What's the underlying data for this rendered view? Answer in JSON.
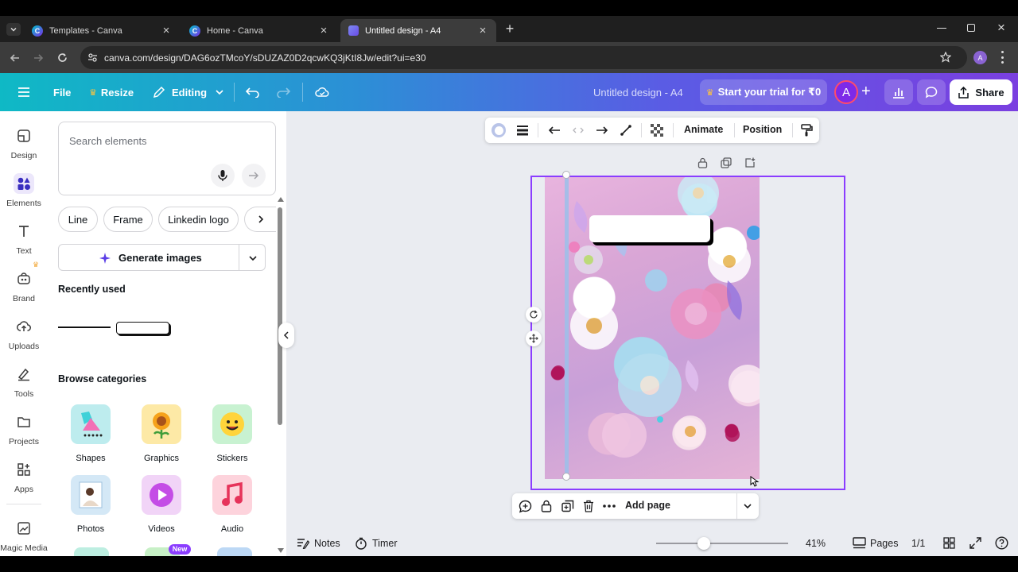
{
  "browser": {
    "tabs": [
      {
        "label": "Templates - Canva",
        "active": false
      },
      {
        "label": "Home - Canva",
        "active": false
      },
      {
        "label": "Untitled design - A4",
        "active": true
      }
    ],
    "url": "canva.com/design/DAG6ozTMcoY/sDUZAZ0D2qcwKQ3jKtI8Jw/edit?ui=e30",
    "profile_initial": "A"
  },
  "header": {
    "file_label": "File",
    "resize_label": "Resize",
    "editing_label": "Editing",
    "doc_title": "Untitled design - A4",
    "trial_label": "Start your trial for ₹0",
    "avatar_initial": "A",
    "share_label": "Share"
  },
  "rail": [
    {
      "label": "Design",
      "icon": "design-icon"
    },
    {
      "label": "Elements",
      "icon": "elements-icon"
    },
    {
      "label": "Text",
      "icon": "text-icon"
    },
    {
      "label": "Brand",
      "icon": "brand-icon"
    },
    {
      "label": "Uploads",
      "icon": "uploads-icon"
    },
    {
      "label": "Tools",
      "icon": "tools-icon"
    },
    {
      "label": "Projects",
      "icon": "projects-icon"
    },
    {
      "label": "Apps",
      "icon": "apps-icon"
    },
    {
      "label": "Magic Media",
      "icon": "magic-media-icon"
    }
  ],
  "panel": {
    "search_placeholder": "Search elements",
    "chips": [
      "Line",
      "Frame",
      "Linkedin logo"
    ],
    "generate_label": "Generate images",
    "recently_used": "Recently used",
    "browse_categories": "Browse categories",
    "categories": [
      "Shapes",
      "Graphics",
      "Stickers",
      "Photos",
      "Videos",
      "Audio"
    ],
    "new_badge": "New"
  },
  "context_toolbar": {
    "animate_label": "Animate",
    "position_label": "Position"
  },
  "page_toolbar": {
    "add_page_label": "Add page"
  },
  "footer": {
    "notes_label": "Notes",
    "timer_label": "Timer",
    "zoom": "41%",
    "zoom_level": 0.41,
    "pages_label": "Pages",
    "page_count": "1/1"
  },
  "colors": {
    "accent": "#8b3dff",
    "header_start": "#0fb9c5",
    "header_end": "#7a3fe0"
  }
}
